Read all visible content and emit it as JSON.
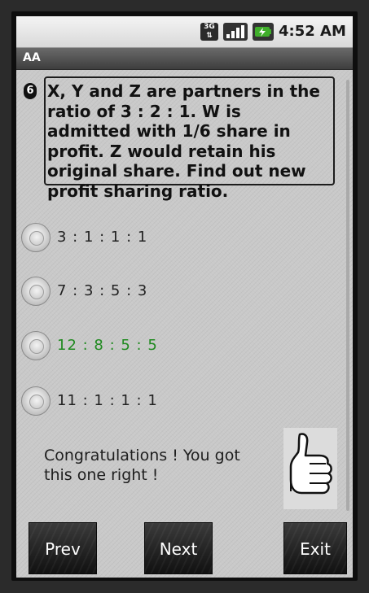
{
  "status_bar": {
    "network_label": "3G",
    "time": "4:52 AM",
    "icons": [
      "3g-data-icon",
      "signal-icon",
      "battery-charging-icon"
    ]
  },
  "app": {
    "title": "AA"
  },
  "question": {
    "number": "6",
    "text": "X, Y and Z are partners in the ratio of 3 : 2 : 1. W is admitted with 1/6 share in profit. Z would retain his original share. Find out new profit sharing ratio."
  },
  "options": [
    {
      "label": "3 : 1 : 1 : 1",
      "correct": false
    },
    {
      "label": "7 : 3 : 5 : 3",
      "correct": false
    },
    {
      "label": "12 : 8 : 5 : 5",
      "correct": true
    },
    {
      "label": "11 : 1 : 1 : 1",
      "correct": false
    }
  ],
  "feedback": {
    "message": "Congratulations ! You got this one right !"
  },
  "buttons": {
    "prev": "Prev",
    "next": "Next",
    "exit": "Exit"
  },
  "colors": {
    "correct_answer": "#1f8a1f",
    "title_bar": "#4a4a4a",
    "button": "#1e1e1e"
  }
}
